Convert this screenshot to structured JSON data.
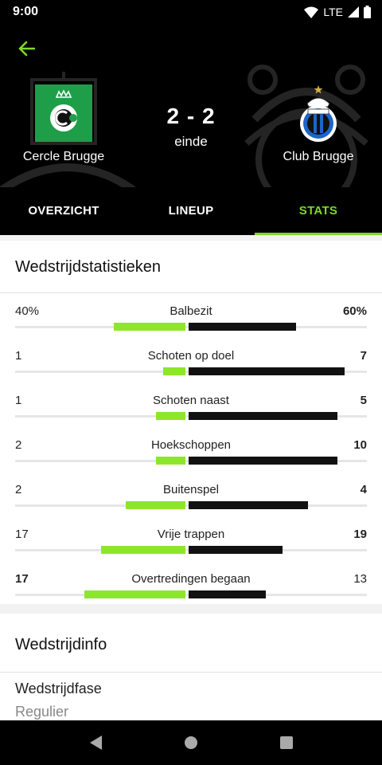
{
  "status_bar": {
    "time": "9:00",
    "network": "LTE"
  },
  "header": {
    "home_team": {
      "name": "Cercle Brugge",
      "logo_icon": "cercle-brugge-logo"
    },
    "away_team": {
      "name": "Club Brugge",
      "logo_icon": "club-brugge-logo"
    },
    "score": "2 - 2",
    "state": "einde"
  },
  "tabs": [
    {
      "label": "OVERZICHT",
      "active": false
    },
    {
      "label": "LINEUP",
      "active": false
    },
    {
      "label": "STATS",
      "active": true
    }
  ],
  "stats": {
    "title": "Wedstrijdstatistieken",
    "rows": [
      {
        "label": "Balbezit",
        "home": "40%",
        "away": "60%",
        "home_value": 40,
        "away_value": 60,
        "bold_side": "away"
      },
      {
        "label": "Schoten op doel",
        "home": "1",
        "away": "7",
        "home_value": 1,
        "away_value": 7,
        "bold_side": "away"
      },
      {
        "label": "Schoten naast",
        "home": "1",
        "away": "5",
        "home_value": 1,
        "away_value": 5,
        "bold_side": "away"
      },
      {
        "label": "Hoekschoppen",
        "home": "2",
        "away": "10",
        "home_value": 2,
        "away_value": 10,
        "bold_side": "away"
      },
      {
        "label": "Buitenspel",
        "home": "2",
        "away": "4",
        "home_value": 2,
        "away_value": 4,
        "bold_side": "away"
      },
      {
        "label": "Vrije trappen",
        "home": "17",
        "away": "19",
        "home_value": 17,
        "away_value": 19,
        "bold_side": "away"
      },
      {
        "label": "Overtredingen begaan",
        "home": "17",
        "away": "13",
        "home_value": 17,
        "away_value": 13,
        "bold_side": "home"
      }
    ]
  },
  "info": {
    "title": "Wedstrijdinfo",
    "phase_label": "Wedstrijdfase",
    "phase_value": "Regulier"
  },
  "colors": {
    "accent": "#7dd82a",
    "home_bar": "#8ee62a",
    "away_bar": "#111111",
    "cercle_green": "#1e9e49"
  }
}
